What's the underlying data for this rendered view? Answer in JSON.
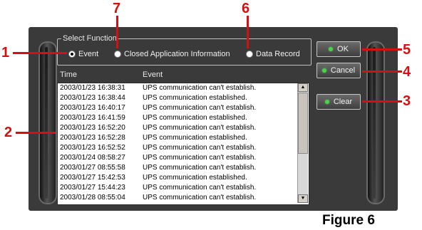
{
  "select_function": {
    "legend": "Select Function",
    "options": [
      {
        "label": "Event",
        "selected": true
      },
      {
        "label": "Closed Application Information",
        "selected": false
      },
      {
        "label": "Data Record",
        "selected": false
      }
    ]
  },
  "list": {
    "headers": {
      "time": "Time",
      "event": "Event"
    },
    "rows": [
      {
        "time": "2003/01/23 16:38:31",
        "event": "UPS communication can't establish."
      },
      {
        "time": "2003/01/23 16:38:44",
        "event": "UPS communication established."
      },
      {
        "time": "2003/01/23 16:40:17",
        "event": "UPS communication can't establish."
      },
      {
        "time": "2003/01/23 16:41:59",
        "event": "UPS communication established."
      },
      {
        "time": "2003/01/23 16:52:20",
        "event": "UPS communication can't establish."
      },
      {
        "time": "2003/01/23 16:52:28",
        "event": "UPS communication established."
      },
      {
        "time": "2003/01/23 16:52:52",
        "event": "UPS communication can't establish."
      },
      {
        "time": "2003/01/24 08:58:27",
        "event": "UPS communication can't establish."
      },
      {
        "time": "2003/01/27 08:55:58",
        "event": "UPS communication can't establish."
      },
      {
        "time": "2003/01/27 15:42:53",
        "event": "UPS communication established."
      },
      {
        "time": "2003/01/27 15:44:23",
        "event": "UPS communication can't establish."
      },
      {
        "time": "2003/01/28 08:55:04",
        "event": "UPS communication can't establish."
      }
    ]
  },
  "buttons": {
    "ok": "OK",
    "cancel": "Cancel",
    "clear": "Clear"
  },
  "callouts": {
    "c1": "1",
    "c2": "2",
    "c3": "3",
    "c4": "4",
    "c5": "5",
    "c6": "6",
    "c7": "7"
  },
  "caption": "Figure 6",
  "colors": {
    "callout": "#d41010",
    "panel": "#3a3a3a",
    "led": "#4cd04c"
  }
}
